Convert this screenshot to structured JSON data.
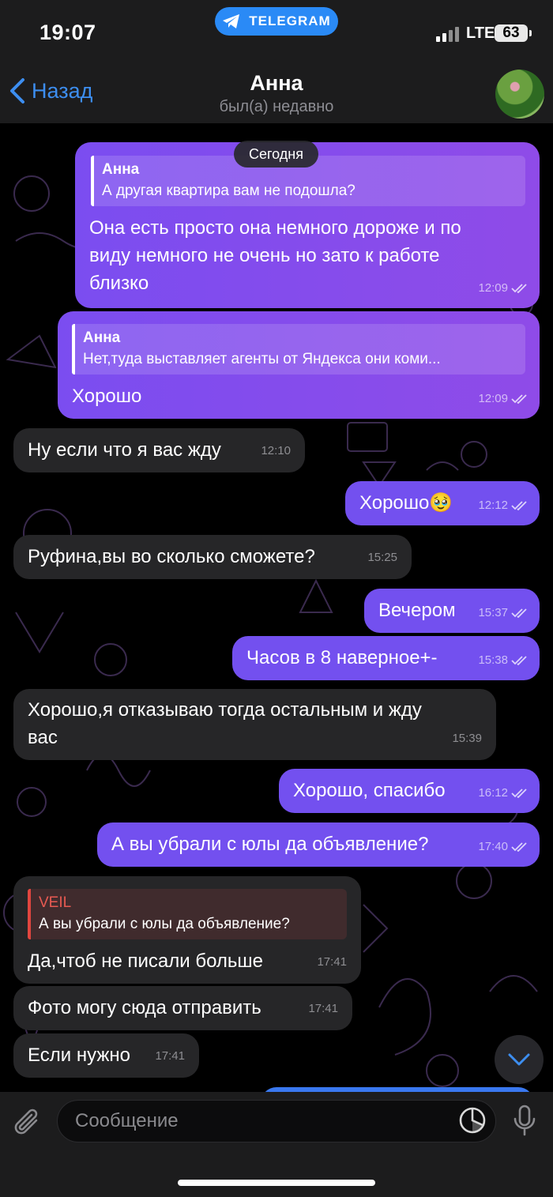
{
  "status": {
    "time": "19:07",
    "app_pill": "TELEGRAM",
    "network": "LTE",
    "battery": "63"
  },
  "header": {
    "back_label": "Назад",
    "title": "Анна",
    "subtitle": "был(а) недавно"
  },
  "date_label": "Сегодня",
  "messages": [
    {
      "dir": "out",
      "reply_name": "Анна",
      "reply_text": "А другая квартира вам не подошла?",
      "lines": [
        "Она есть просто она немного дороже и по",
        "виду немного не очень но зато к работе",
        "близко"
      ],
      "time": "12:09"
    },
    {
      "dir": "out",
      "reply_name": "Анна",
      "reply_text": "Нет,туда выставляет агенты от Яндекса они коми...",
      "text": "Хорошо",
      "time": "12:09"
    },
    {
      "dir": "in",
      "text": "Ну если что я вас жду",
      "time": "12:10"
    },
    {
      "dir": "out",
      "text": "Хорошо🥹",
      "time": "12:12"
    },
    {
      "dir": "in",
      "text": "Руфина,вы во сколько сможете?",
      "time": "15:25"
    },
    {
      "dir": "out",
      "text": "Вечером",
      "time": "15:37"
    },
    {
      "dir": "out",
      "text": "Часов в 8 наверное+-",
      "time": "15:38"
    },
    {
      "dir": "in",
      "lines": [
        "Хорошо,я отказываю тогда остальным и жду",
        "вас"
      ],
      "time": "15:39"
    },
    {
      "dir": "out",
      "text": "Хорошо, спасибо",
      "time": "16:12"
    },
    {
      "dir": "out",
      "text": "А вы убрали с юлы да объявление?",
      "time": "17:40"
    },
    {
      "dir": "in",
      "reply_name": "VEIL",
      "reply_text": "А вы убрали с юлы да объявление?",
      "text": "Да,чтоб не писали больше",
      "time": "17:41"
    },
    {
      "dir": "in",
      "text": "Фото могу сюда отправить",
      "time": "17:41"
    },
    {
      "dir": "in",
      "text": "Если нужно",
      "time": "17:41"
    }
  ],
  "input": {
    "placeholder": "Сообщение"
  },
  "colors": {
    "accent": "#3d8ef0",
    "outgoing_bubble": "#7b4df0",
    "incoming_bubble": "#262628",
    "reply_name_in": "#e85a52"
  }
}
